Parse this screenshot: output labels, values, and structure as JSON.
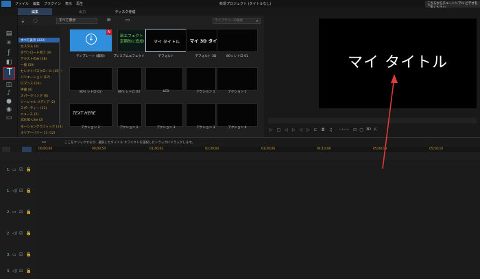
{
  "menubar": {
    "items": [
      "ファイル",
      "編集",
      "プラグイン",
      "表示",
      "再生"
    ],
    "window_title": "新規プロジェクト (タイトルなし)",
    "tutorial_label": "こちらからチュートリアル ビデオをご覧ください"
  },
  "modebar": {
    "edit_tab": "編集",
    "produce_tab": "出力",
    "disc_tab": "ディスク作成"
  },
  "toolbar": {
    "filter_label": "すべて表示",
    "search_placeholder": "ライブラリーの検索"
  },
  "categories": [
    "すべて表示 (222)",
    "カスタム (0)",
    "ダウンロード完了 (0)",
    "テキストのみ (38)",
    "一般 (50)",
    "セレクトパスクロール (15)",
    "バリエーション (17)",
    "ロマンス (10)",
    "手書 (6)",
    "スパークリング (6)",
    "ソーシャル メディア (2)",
    "スポーティー (13)",
    "ニュース (2)",
    "3D/3D-Like (2)",
    "モーショングラフィック (14)",
    "ホリデーバリー 11 (12)"
  ],
  "library": {
    "row1": [
      "テンプレート (無料)",
      "プレミアムエフェクト",
      "デフォルト",
      "デフォルト 3D",
      "80's レトロ 01"
    ],
    "row2": [
      "80's レトロ 02",
      "80's レトロ 03",
      "LED",
      "アクション 1",
      "アクション 1"
    ],
    "row3": [
      "アクション 2",
      "アクション 2",
      "アクション 3",
      "アクション 3",
      "アクション 4"
    ],
    "thumb_texts": {
      "effect": "新エフェクト\n定期的に追加!",
      "default": "マイ タイトル",
      "default3d": "マイ 3D タイトル",
      "handwritten": "TEXT HERE",
      "badge": "N"
    }
  },
  "preview": {
    "title_text": "マイ タイトル",
    "timecode": "--:--:--",
    "fit_label": "3D"
  },
  "timeline": {
    "hint": "ここをクリックするか、選択したタイトル エフェクトを選択したトラックにドラッグします。",
    "ticks": [
      "00;00;00",
      "00;00;50",
      "01;40;02",
      "02;30;04",
      "03;20;06",
      "04;10;08",
      "05;00;10",
      "05;50;10"
    ],
    "tracks": [
      "1.",
      "1.",
      "2.",
      "2.",
      "3.",
      "3."
    ]
  },
  "colors": {
    "accent_red": "#d01b2d",
    "selection_blue": "#2d62a8",
    "category_text": "#d6a23c",
    "ruler_text": "#d8a23a",
    "annotation_arrow": "#e23b3b"
  }
}
